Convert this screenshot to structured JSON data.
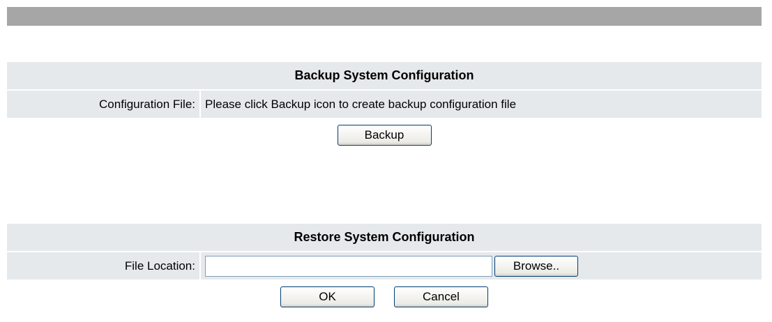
{
  "backup": {
    "title": "Backup System Configuration",
    "config_label": "Configuration File:",
    "config_message": "Please click Backup icon to create backup configuration file",
    "backup_button": "Backup"
  },
  "restore": {
    "title": "Restore System Configuration",
    "file_location_label": "File Location:",
    "file_location_value": "",
    "browse_button": "Browse..",
    "ok_button": "OK",
    "cancel_button": "Cancel"
  },
  "colors": {
    "header_bar": "#a6a6a6",
    "row_background": "#e6e9ec",
    "button_border": "#003c74"
  }
}
